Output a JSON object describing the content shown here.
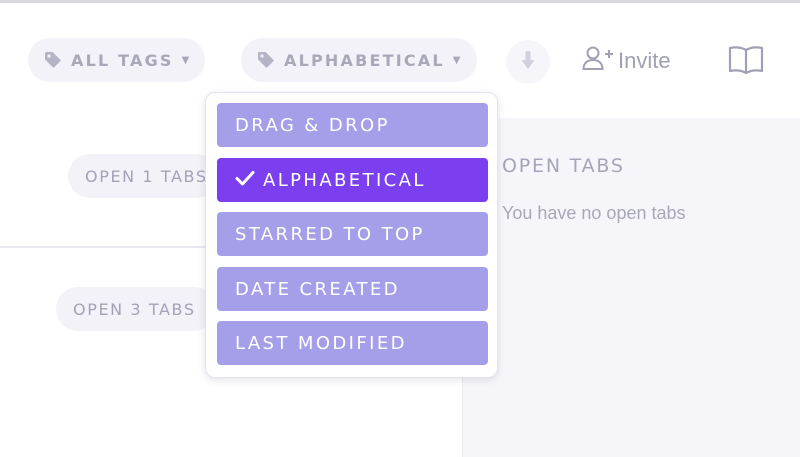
{
  "toolbar": {
    "tags_filter": {
      "label": "ALL TAGS",
      "icon": "tag-icon"
    },
    "sort_filter": {
      "label": "ALPHABETICAL",
      "icon": "tag-icon"
    },
    "sort_direction": {
      "icon": "arrow-down-icon"
    },
    "invite": {
      "label": "Invite",
      "icon": "user-plus-icon"
    },
    "docs": {
      "icon": "book-icon"
    }
  },
  "groups": [
    {
      "button_label": "OPEN 1 TABS"
    },
    {
      "button_label": "OPEN 3 TABS"
    }
  ],
  "open_tabs_panel": {
    "title": "OPEN TABS",
    "empty_message": "You have no open tabs"
  },
  "sort_menu": {
    "selected": "ALPHABETICAL",
    "options": [
      {
        "label": "DRAG & DROP",
        "selected": false
      },
      {
        "label": "ALPHABETICAL",
        "selected": true
      },
      {
        "label": "STARRED TO TOP",
        "selected": false
      },
      {
        "label": "DATE CREATED",
        "selected": false
      },
      {
        "label": "LAST MODIFIED",
        "selected": false
      }
    ]
  },
  "colors": {
    "accent": "#7c3ff0",
    "menu_item": "#a59ee9",
    "pill_bg": "#f3f2f8",
    "muted_text": "#a7a6b8"
  }
}
